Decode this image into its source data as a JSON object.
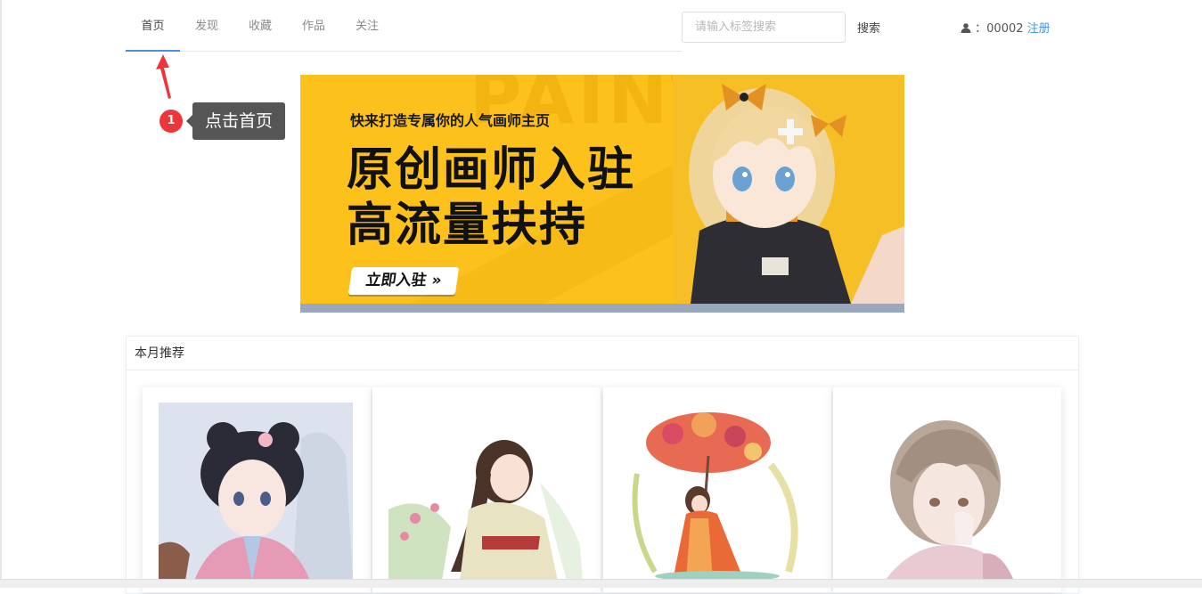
{
  "nav": {
    "items": [
      {
        "label": "首页",
        "active": true
      },
      {
        "label": "发现"
      },
      {
        "label": "收藏"
      },
      {
        "label": "作品"
      },
      {
        "label": "关注"
      }
    ],
    "active_color": "#4a90e2"
  },
  "search": {
    "placeholder": "请输入标签搜索",
    "button_label": "搜索"
  },
  "user": {
    "icon": "user-icon",
    "id": "00002",
    "separator": "：",
    "register_label": "注册",
    "link_color": "#4a90e2"
  },
  "annotation": {
    "step": "1",
    "text": "点击首页",
    "marker_color": "#f0353a"
  },
  "banner": {
    "subtitle": "快来打造专属你的人气画师主页",
    "title_line1": "原创画师入驻",
    "title_line2": "高流量扶持",
    "cta_label": "立即入驻 »",
    "background_text": "PAINT",
    "background_color": "#fcc21b",
    "slide_count": 2,
    "active_slide": 1
  },
  "recommend": {
    "title": "本月推荐",
    "cards": [
      {
        "image": "girl-pink-hanfu-illustration"
      },
      {
        "image": "girl-cream-hanfu-flowers-illustration"
      },
      {
        "image": "girl-red-dress-flower-umbrella-illustration"
      },
      {
        "image": "girl-short-hair-portrait-illustration"
      }
    ]
  }
}
